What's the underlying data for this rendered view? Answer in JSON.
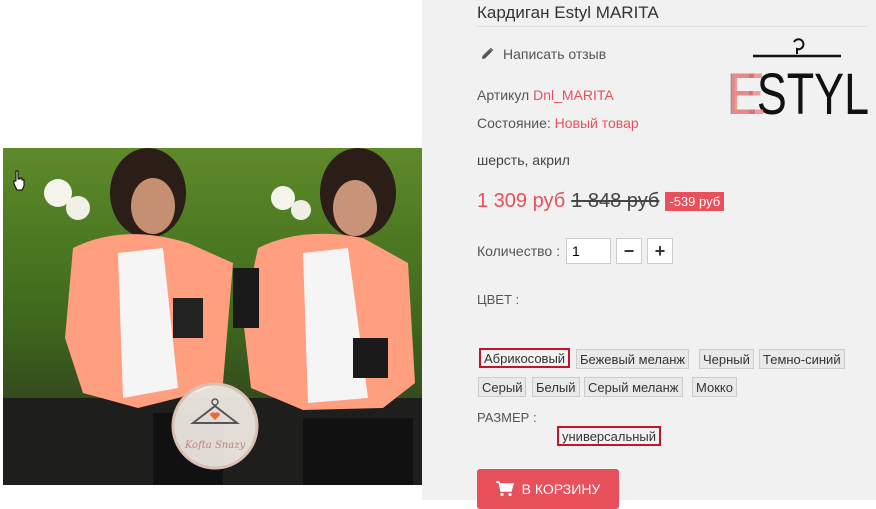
{
  "product": {
    "title": "Кардиган Estyl MARITA",
    "review_label": "Написать отзыв",
    "sku_label": "Артикул",
    "sku_value": "Dnl_MARITA",
    "condition_label": "Состояние:",
    "condition_value": "Новый товар",
    "material": "шерсть, акрил",
    "price": "1 309 руб",
    "old_price": "1 848 руб",
    "discount": "-539 руб"
  },
  "quantity": {
    "label": "Количество :",
    "value": "1",
    "minus": "−",
    "plus": "+"
  },
  "color": {
    "label": "ЦВЕТ :",
    "options": [
      "Абрикосовый",
      "Бежевый меланж",
      "Черный",
      "Темно-синий",
      "Серый",
      "Белый",
      "Серый меланж",
      "Мокко"
    ],
    "selected": "Абрикосовый"
  },
  "size": {
    "label": "РАЗМЕР :",
    "options": [
      "универсальный"
    ],
    "selected": "универсальный"
  },
  "cart": {
    "label": "В КОРЗИНУ"
  },
  "logo": {
    "text": "ESTYL"
  },
  "watermark": {
    "text": "Kofta Snazy"
  },
  "colors": {
    "accent": "#e8505b",
    "selected_border": "#c0152a",
    "panel_bg": "#f1f1f1"
  }
}
